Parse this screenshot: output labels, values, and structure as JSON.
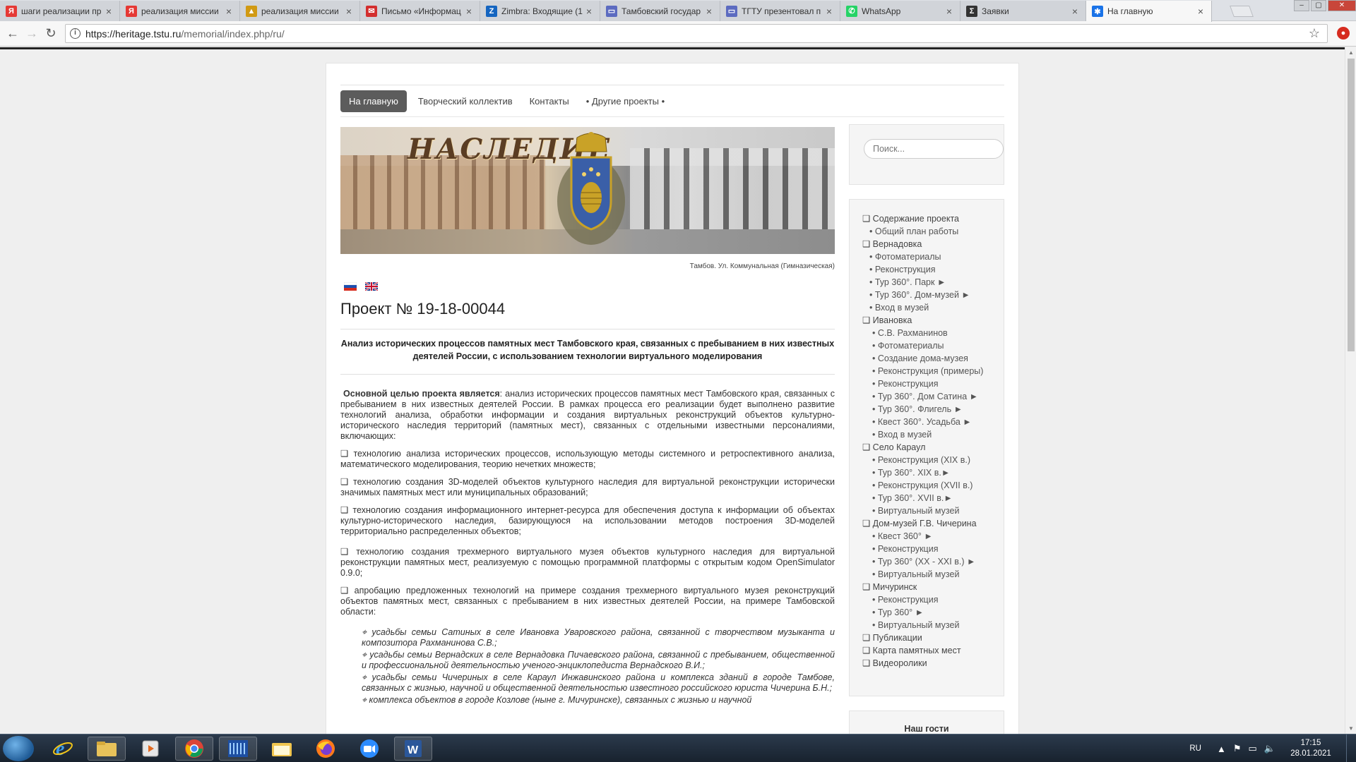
{
  "browser": {
    "tabs": [
      {
        "title": "шаги реализации пр",
        "favicon": "yandex-icon",
        "color": "#e53935"
      },
      {
        "title": "реализация миссии",
        "favicon": "yandex-icon",
        "color": "#e53935"
      },
      {
        "title": "реализация миссии",
        "favicon": "folder-icon",
        "color": "#d19a14"
      },
      {
        "title": "Письмо «Информац",
        "favicon": "mail-icon",
        "color": "#d32f2f"
      },
      {
        "title": "Zimbra: Входящие (1",
        "favicon": "zimbra-icon",
        "color": "#1565c0"
      },
      {
        "title": "Тамбовский государ",
        "favicon": "site-icon",
        "color": "#5c6bc0"
      },
      {
        "title": "ТГТУ презентовал п",
        "favicon": "site-icon",
        "color": "#5c6bc0"
      },
      {
        "title": "WhatsApp",
        "favicon": "whatsapp-icon",
        "color": "#25d366"
      },
      {
        "title": "Заявки",
        "favicon": "z-icon",
        "color": "#333333"
      },
      {
        "title": "На главную",
        "favicon": "joomla-icon",
        "color": "#1a73e8",
        "active": true
      }
    ],
    "url_host": "https://heritage.tstu.ru",
    "url_path": "/memorial/index.php/ru/"
  },
  "site": {
    "menu": [
      "На главную",
      "Творческий коллектив",
      "Контакты",
      "• Другие проекты •"
    ],
    "banner_logo": "НАСЛЕДИЕ",
    "banner_caption": "Тамбов. Ул. Коммунальная (Гимназическая)",
    "languages": [
      "ru",
      "en"
    ],
    "title": "Проект № 19-18-00044",
    "subtitle": "Анализ исторических процессов памятных мест Тамбовского края, связанных с пребыванием в них известных деятелей России, с использованием технологии виртуального моделирования",
    "intro_bold": "Основной целью проекта является",
    "intro_rest": ": анализ исторических процессов памятных мест Тамбовского края, связанных с пребыванием в них известных деятелей России. В рамках процесса его реализации будет выполнено развитие технологий анализа, обработки информации и создания виртуальных реконструкций объектов культурно-исторического наследия территорий (памятных мест), связанных с отдельными известными персоналиями, включающих:",
    "points": [
      "❑ технологию анализа исторических процессов, использующую методы системного и ретроспективного анализа, математического моделирования, теорию нечетких множеств;",
      "❑ технологию создания 3D-моделей объектов культурного наследия для виртуальной реконструкции исторически значимых памятных мест или муниципальных образований;",
      "❑ технологию создания информационного интернет-ресурса для обеспечения доступа к информации об объектах культурно-исторического наследия, базирующуюся на использовании методов построения 3D-моделей территориально распределенных объектов;",
      "❑ технологию создания трехмерного виртуального музея объектов культурного наследия для виртуальной реконструкции памятных мест, реализуемую с помощью программной платформы с открытым кодом OpenSimulator 0.9.0;",
      "❑ апробацию предложенных технологий на примере создания трехмерного виртуального музея реконструкций объектов памятных мест, связанных с пребыванием в них известных деятелей России, на примере Тамбовской области:"
    ],
    "estates": [
      "⌖ усадьбы семьи Сатиных в селе Ивановка Уваровского района, связанной с творчеством музыканта и композитора Рахманинова С.В.;",
      "⌖ усадьбы семьи Вернадских в селе Вернадовка Пичаевского района, связанной с пребыванием, общественной и профессиональной деятельностью ученого-энциклопедиста Вернадского В.И.;",
      "⌖ усадьбы семьи Чичериных в селе Караул Инжавинского района и комплекса зданий в городе Тамбове, связанных с жизнью, научной и общественной деятельностью известного российского юриста Чичерина Б.Н.;",
      "⌖ комплекса объектов в городе Козлове (ныне г. Мичуринске), связанных с жизнью и научной"
    ],
    "search_placeholder": "Поиск...",
    "sidebar": [
      {
        "t": "❑ Содержание проекта",
        "lvl": 0
      },
      {
        "t": "• Общий план работы",
        "lvl": 1
      },
      {
        "t": "❑ Вернадовка",
        "lvl": 0
      },
      {
        "t": "• Фотоматериалы",
        "lvl": 1
      },
      {
        "t": "• Реконструкция",
        "lvl": 1
      },
      {
        "t": "• Тур 360°. Парк ►",
        "lvl": 1
      },
      {
        "t": "• Тур 360°. Дом-музей ►",
        "lvl": 1
      },
      {
        "t": "• Вход в музей",
        "lvl": 1
      },
      {
        "t": "❑ Ивановка",
        "lvl": 0
      },
      {
        "t": "• С.В. Рахманинов",
        "lvl": 2
      },
      {
        "t": "• Фотоматериалы",
        "lvl": 2
      },
      {
        "t": "• Создание дома-музея",
        "lvl": 2
      },
      {
        "t": "• Реконструкция (примеры)",
        "lvl": 2
      },
      {
        "t": "• Реконструкция",
        "lvl": 2
      },
      {
        "t": "• Тур 360°. Дом Сатина ►",
        "lvl": 2
      },
      {
        "t": "• Тур 360°. Флигель ►",
        "lvl": 2
      },
      {
        "t": "• Квест 360°. Усадьба ►",
        "lvl": 2
      },
      {
        "t": "• Вход в музей",
        "lvl": 2
      },
      {
        "t": "❑ Село Караул",
        "lvl": 0
      },
      {
        "t": "• Реконструкция (XIX в.)",
        "lvl": 2
      },
      {
        "t": "• Тур 360°. XIX в.►",
        "lvl": 2
      },
      {
        "t": "• Реконструкция (XVII в.)",
        "lvl": 2
      },
      {
        "t": "• Тур 360°. XVII в.►",
        "lvl": 2
      },
      {
        "t": "• Виртуальный музей",
        "lvl": 2
      },
      {
        "t": "❑ Дом-музей Г.В. Чичерина",
        "lvl": 0
      },
      {
        "t": "• Квест 360° ►",
        "lvl": 2
      },
      {
        "t": "• Реконструкция",
        "lvl": 2
      },
      {
        "t": "• Тур 360° (XX - XXI в.) ►",
        "lvl": 2
      },
      {
        "t": "• Виртуальный музей",
        "lvl": 2
      },
      {
        "t": "❑ Мичуринск",
        "lvl": 0
      },
      {
        "t": "• Реконструкция",
        "lvl": 2
      },
      {
        "t": "• Тур 360° ►",
        "lvl": 2
      },
      {
        "t": "• Виртуальный музей",
        "lvl": 2
      },
      {
        "t": "❑ Публикации",
        "lvl": 0
      },
      {
        "t": "❑ Карта памятных мест",
        "lvl": 0
      },
      {
        "t": "❑ Видеоролики",
        "lvl": 0
      }
    ],
    "guests_heading": "Наш гости"
  },
  "taskbar": {
    "apps": [
      "start",
      "ie-icon",
      "explorer-icon",
      "media-icon",
      "chrome-icon",
      "app-icon",
      "folder-icon",
      "firefox-icon",
      "zoom-icon",
      "word-icon"
    ],
    "lang": "RU",
    "time": "17:15",
    "date": "28.01.2021"
  }
}
